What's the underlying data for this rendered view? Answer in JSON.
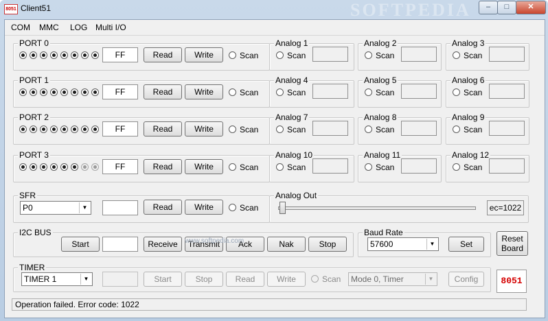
{
  "window": {
    "title": "Client51",
    "icon_text": "8051",
    "watermark": "SOFTPEDIA",
    "controls": {
      "minimize": "–",
      "maximize": "□",
      "close": "✕"
    }
  },
  "menu": [
    "COM",
    "MMC",
    "LOG",
    "Multi I/O"
  ],
  "ports": [
    {
      "label": "PORT 0",
      "value": "FF",
      "read": "Read",
      "write": "Write",
      "scan": "Scan",
      "bits": [
        1,
        1,
        1,
        1,
        1,
        1,
        1,
        1
      ]
    },
    {
      "label": "PORT 1",
      "value": "FF",
      "read": "Read",
      "write": "Write",
      "scan": "Scan",
      "bits": [
        1,
        1,
        1,
        1,
        1,
        1,
        1,
        1
      ]
    },
    {
      "label": "PORT 2",
      "value": "FF",
      "read": "Read",
      "write": "Write",
      "scan": "Scan",
      "bits": [
        1,
        1,
        1,
        1,
        1,
        1,
        1,
        1
      ]
    },
    {
      "label": "PORT 3",
      "value": "FF",
      "read": "Read",
      "write": "Write",
      "scan": "Scan",
      "bits": [
        1,
        1,
        1,
        1,
        1,
        1,
        2,
        2
      ]
    }
  ],
  "analog": [
    {
      "label": "Analog 1",
      "scan": "Scan"
    },
    {
      "label": "Analog 2",
      "scan": "Scan"
    },
    {
      "label": "Analog 3",
      "scan": "Scan"
    },
    {
      "label": "Analog 4",
      "scan": "Scan"
    },
    {
      "label": "Analog 5",
      "scan": "Scan"
    },
    {
      "label": "Analog 6",
      "scan": "Scan"
    },
    {
      "label": "Analog 7",
      "scan": "Scan"
    },
    {
      "label": "Analog 8",
      "scan": "Scan"
    },
    {
      "label": "Analog 9",
      "scan": "Scan"
    },
    {
      "label": "Analog 10",
      "scan": "Scan"
    },
    {
      "label": "Analog 11",
      "scan": "Scan"
    },
    {
      "label": "Analog 12",
      "scan": "Scan"
    }
  ],
  "sfr": {
    "label": "SFR",
    "selected": "P0",
    "read": "Read",
    "write": "Write",
    "scan": "Scan"
  },
  "analog_out": {
    "label": "Analog Out",
    "value_text": "ec=1022",
    "level": 0.0
  },
  "i2c": {
    "label": "I2C BUS",
    "start": "Start",
    "receive": "Receive",
    "transmit": "Transmit",
    "ack": "Ack",
    "nak": "Nak",
    "stop": "Stop"
  },
  "baud": {
    "label": "Baud Rate",
    "selected": "57600",
    "set": "Set"
  },
  "reset_button": "Reset Board",
  "timer": {
    "label": "TIMER",
    "selected": "TIMER 1",
    "start": "Start",
    "stop": "Stop",
    "read": "Read",
    "write": "Write",
    "scan": "Scan",
    "mode": "Mode 0, Timer",
    "config": "Config"
  },
  "logo": "8051",
  "watermark_small": "www.softpedia.com",
  "status": "Operation failed. Error code: 1022"
}
